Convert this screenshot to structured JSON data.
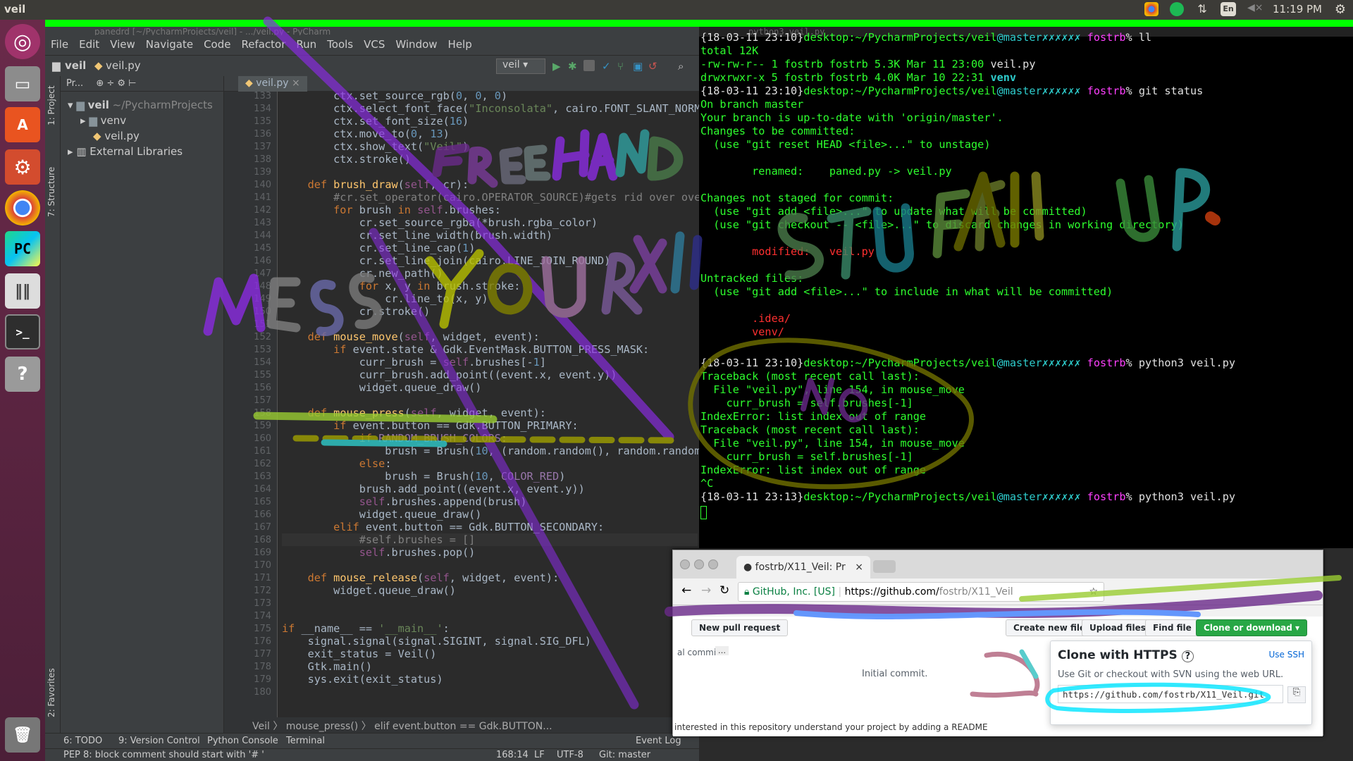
{
  "os": {
    "active_window_title": "veil",
    "clock": "11:19 PM",
    "keyboard_layout": "En",
    "launcher_items": [
      "dash-icon",
      "files-icon",
      "software-center-icon",
      "system-settings-icon",
      "chrome-icon",
      "pycharm-icon",
      "mixer-icon",
      "terminal-icon",
      "help-icon",
      "trash-icon"
    ]
  },
  "ide": {
    "title": "panedrd [~/PycharmProjects/veil] - .../veil.py - PyCharm",
    "menu": [
      "File",
      "Edit",
      "View",
      "Navigate",
      "Code",
      "Refactor",
      "Run",
      "Tools",
      "VCS",
      "Window",
      "Help"
    ],
    "breadcrumb_project": "veil",
    "breadcrumb_file": "veil.py",
    "run_config": "veil",
    "project_panel_label": "Pr...",
    "tree": {
      "root": "veil",
      "root_path": "~/PycharmProjects",
      "venv": "venv",
      "file": "veil.py",
      "external": "External Libraries"
    },
    "side_tabs": {
      "project": "1: Project",
      "structure": "7: Structure",
      "favorites": "2: Favorites"
    },
    "editor_tab": "veil.py",
    "code_crumb": [
      "Veil",
      "mouse_press()",
      "elif event.button == Gdk.BUTTON..."
    ],
    "bottom_tools": {
      "todo": "6: TODO",
      "vc": "9: Version Control",
      "console": "Python Console",
      "terminal": "Terminal",
      "eventlog": "Event Log"
    },
    "status": {
      "message": "PEP 8: block comment should start with '# '",
      "position": "168:14",
      "line_sep": "LF",
      "encoding": "UTF-8",
      "git": "Git: master"
    },
    "line_numbers": [
      "133",
      "134",
      "135",
      "136",
      "137",
      "138",
      "139",
      "140",
      "141",
      "142",
      "143",
      "144",
      "145",
      "146",
      "147",
      "148",
      "149",
      "150",
      "151",
      "152",
      "153",
      "154",
      "155",
      "156",
      "157",
      "158",
      "159",
      "160",
      "161",
      "162",
      "163",
      "164",
      "165",
      "166",
      "167",
      "168",
      "169",
      "170",
      "171",
      "172",
      "173",
      "174",
      "175",
      "176",
      "177",
      "178",
      "179",
      "180"
    ]
  },
  "terminal": {
    "title": "python3 veil.py",
    "prompt_time1": "{18-03-11 23:10}",
    "prompt_time2": "{18-03-11 23:13}",
    "host_path": "desktop:~/PycharmProjects/veil",
    "branch": "@master",
    "dirty": "✗✗✗✗✗✗",
    "user": "fostrb",
    "cmd_ll": "% ll",
    "total": "total 12K",
    "ls1": "-rw-rw-r-- 1 fostrb fostrb 5.3K Mar 11 23:00 ",
    "ls1_name": "veil.py",
    "ls2": "drwxrwxr-x 5 fostrb fostrb 4.0K Mar 10 22:31 ",
    "ls2_name": "venv",
    "cmd_status": "% git status",
    "s1": "On branch master",
    "s2": "Your branch is up-to-date with 'origin/master'.",
    "s3": "Changes to be committed:",
    "s4": "  (use \"git reset HEAD <file>...\" to unstage)",
    "s5": "        renamed:    paned.py -> veil.py",
    "s6": "Changes not staged for commit:",
    "s7": "  (use \"git add <file>...\" to update what will be committed)",
    "s8": "  (use \"git checkout -- <file>...\" to discard changes in working directory)",
    "s9": "        modified:   veil.py",
    "s10": "Untracked files:",
    "s11": "  (use \"git add <file>...\" to include in what will be committed)",
    "s12": "        .idea/",
    "s13": "        venv/",
    "cmd_py": "% python3 veil.py",
    "t1": "Traceback (most recent call last):",
    "t2": "  File \"veil.py\", line 154, in mouse_move",
    "t3": "    curr_brush = self.brushes[-1]",
    "t4": "IndexError: list index out of range",
    "t5": "Traceback (most recent call last):",
    "t6": "  File \"veil.py\", line 154, in mouse_move",
    "t7": "    curr_brush = self.brushes[-1]",
    "t8": "IndexError: list index out of range",
    "t9": "^C"
  },
  "browser": {
    "tab_title": "fostrb/X11_Veil: Pr",
    "security": "GitHub, Inc. [US]",
    "url_prefix": "https://github.com/",
    "url_rest": "fostrb/X11_Veil",
    "new_pr": "New pull request",
    "create_file": "Create new file",
    "upload": "Upload files",
    "find": "Find file",
    "clone": "Clone or download ▾",
    "commit_label": "al commit.",
    "commit_more": "…",
    "initial_commit": "Initial commit.",
    "clone_title": "Clone with HTTPS",
    "use_ssh": "Use SSH",
    "clone_sub": "Use Git or checkout with SVN using the web URL.",
    "clone_url": "https://github.com/fostrb/X11_Veil.git",
    "readme_hint": "interested in this repository understand your project by adding a README"
  }
}
